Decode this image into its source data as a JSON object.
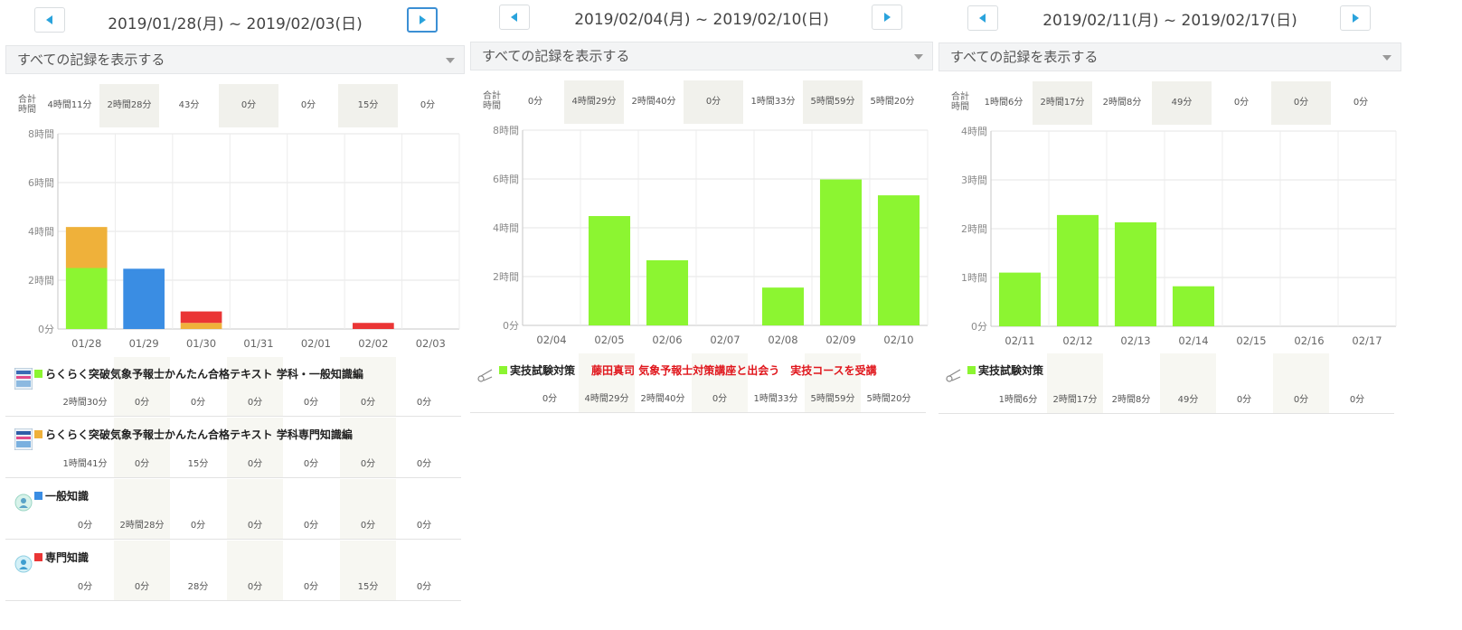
{
  "colors": {
    "green": "#8cf531",
    "orange": "#efb13a",
    "blue": "#3a8de3",
    "red": "#ea3535",
    "nav_arrow": "#2aa3dc"
  },
  "filter_label": "すべての記録を表示する",
  "totals_label_line1": "合計",
  "totals_label_line2": "時間",
  "nav": {
    "prev_icon": "triangle-left-icon",
    "next_icon": "triangle-right-icon"
  },
  "panels": [
    {
      "range": "2019/01/28(月) ~ 2019/02/03(日)",
      "totals": [
        "4時間11分",
        "2時間28分",
        "43分",
        "0分",
        "0分",
        "15分",
        "0分"
      ],
      "subjects": [
        {
          "color": "#8cf531",
          "title": "らくらく突破気象予報士かんたん合格テキスト 学科・一般知識編",
          "note": "",
          "icon": "book-cover-icon",
          "values": [
            "2時間30分",
            "0分",
            "0分",
            "0分",
            "0分",
            "0分",
            "0分"
          ]
        },
        {
          "color": "#efb13a",
          "title": "らくらく突破気象予報士かんたん合格テキスト 学科専門知識編",
          "note": "",
          "icon": "book-cover-icon",
          "values": [
            "1時間41分",
            "0分",
            "15分",
            "0分",
            "0分",
            "0分",
            "0分"
          ]
        },
        {
          "color": "#3a8de3",
          "title": "一般知識",
          "note": "",
          "icon": "subject-avatar-icon",
          "values": [
            "0分",
            "2時間28分",
            "0分",
            "0分",
            "0分",
            "0分",
            "0分"
          ]
        },
        {
          "color": "#ea3535",
          "title": "専門知識",
          "note": "",
          "icon": "subject-avatar-icon",
          "values": [
            "0分",
            "0分",
            "28分",
            "0分",
            "0分",
            "15分",
            "0分"
          ]
        }
      ]
    },
    {
      "range": "2019/02/04(月) ~ 2019/02/10(日)",
      "totals": [
        "0分",
        "4時間29分",
        "2時間40分",
        "0分",
        "1時間33分",
        "5時間59分",
        "5時間20分"
      ],
      "subjects": [
        {
          "color": "#8cf531",
          "title": "実技試験対策",
          "note": "藤田真司 気象予報士対策講座と出会う　実技コースを受講",
          "icon": "pencil-icon",
          "values": [
            "0分",
            "4時間29分",
            "2時間40分",
            "0分",
            "1時間33分",
            "5時間59分",
            "5時間20分"
          ]
        }
      ]
    },
    {
      "range": "2019/02/11(月) ~ 2019/02/17(日)",
      "totals": [
        "1時間6分",
        "2時間17分",
        "2時間8分",
        "49分",
        "0分",
        "0分",
        "0分"
      ],
      "subjects": [
        {
          "color": "#8cf531",
          "title": "実技試験対策",
          "note": "",
          "icon": "pencil-icon",
          "values": [
            "1時間6分",
            "2時間17分",
            "2時間8分",
            "49分",
            "0分",
            "0分",
            "0分"
          ]
        }
      ]
    }
  ],
  "chart_data": [
    {
      "type": "bar",
      "stacked": true,
      "categories": [
        "01/28",
        "01/29",
        "01/30",
        "01/31",
        "02/01",
        "02/02",
        "02/03"
      ],
      "yticks": [
        "0分",
        "2時間",
        "4時間",
        "6時間",
        "8時間"
      ],
      "ylim": [
        0,
        8
      ],
      "yunit": "hours",
      "grid": true,
      "series": [
        {
          "color": "#8cf531",
          "values": [
            2.5,
            0,
            0,
            0,
            0,
            0,
            0
          ]
        },
        {
          "color": "#efb13a",
          "values": [
            1.68,
            0,
            0.25,
            0,
            0,
            0,
            0
          ]
        },
        {
          "color": "#3a8de3",
          "values": [
            0,
            2.47,
            0,
            0,
            0,
            0,
            0
          ]
        },
        {
          "color": "#ea3535",
          "values": [
            0,
            0,
            0.47,
            0,
            0,
            0.25,
            0
          ]
        }
      ]
    },
    {
      "type": "bar",
      "stacked": true,
      "categories": [
        "02/04",
        "02/05",
        "02/06",
        "02/07",
        "02/08",
        "02/09",
        "02/10"
      ],
      "yticks": [
        "0分",
        "2時間",
        "4時間",
        "6時間",
        "8時間"
      ],
      "ylim": [
        0,
        8
      ],
      "yunit": "hours",
      "grid": true,
      "series": [
        {
          "color": "#8cf531",
          "values": [
            0,
            4.48,
            2.67,
            0,
            1.55,
            5.98,
            5.33
          ]
        }
      ]
    },
    {
      "type": "bar",
      "stacked": true,
      "categories": [
        "02/11",
        "02/12",
        "02/13",
        "02/14",
        "02/15",
        "02/16",
        "02/17"
      ],
      "yticks": [
        "0分",
        "1時間",
        "2時間",
        "3時間",
        "4時間"
      ],
      "ylim": [
        0,
        4
      ],
      "yunit": "hours",
      "grid": true,
      "series": [
        {
          "color": "#8cf531",
          "values": [
            1.1,
            2.28,
            2.13,
            0.82,
            0,
            0,
            0
          ]
        }
      ]
    }
  ]
}
